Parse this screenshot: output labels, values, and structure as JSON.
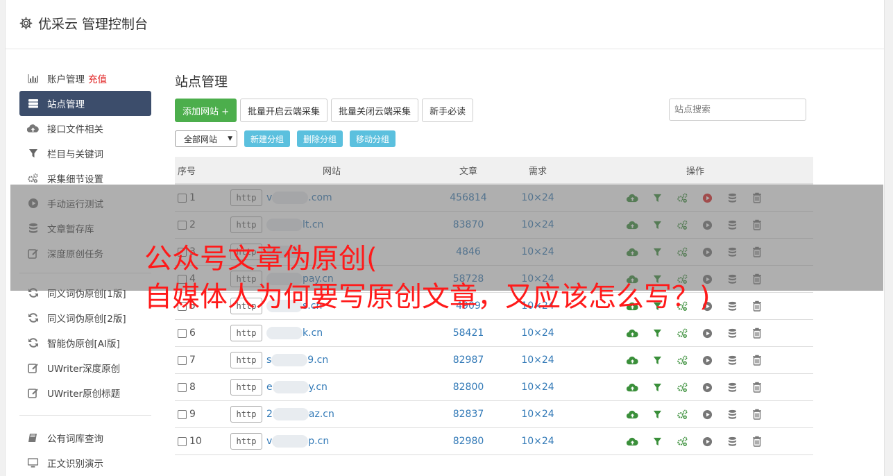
{
  "header": {
    "title": "优采云 管理控制台",
    "icon": "gear-icon"
  },
  "sidebar": {
    "group1": [
      {
        "label": "账户管理",
        "extra": "充值",
        "icon": "bar-chart-icon"
      },
      {
        "label": "站点管理",
        "icon": "server-icon",
        "active": true
      },
      {
        "label": "接口文件相关",
        "icon": "cloud-upload-icon"
      },
      {
        "label": "栏目与关键词",
        "icon": "filter-icon"
      },
      {
        "label": "采集细节设置",
        "icon": "gears-icon"
      },
      {
        "label": "手动运行测试",
        "icon": "play-circle-icon"
      },
      {
        "label": "文章暂存库",
        "icon": "database-icon"
      },
      {
        "label": "深度原创任务",
        "icon": "edit-icon"
      }
    ],
    "group2": [
      {
        "label": "同义词伪原创[1版]",
        "icon": "refresh-icon"
      },
      {
        "label": "同义词伪原创[2版]",
        "icon": "refresh-icon"
      },
      {
        "label": "智能伪原创[AI版]",
        "icon": "refresh-icon"
      },
      {
        "label": "UWriter深度原创",
        "icon": "edit-icon"
      },
      {
        "label": "UWriter原创标题",
        "icon": "edit-icon"
      }
    ],
    "group3": [
      {
        "label": "公有词库查询",
        "icon": "book-icon"
      },
      {
        "label": "正文识别演示",
        "icon": "monitor-icon"
      }
    ]
  },
  "main": {
    "title": "站点管理",
    "buttons": {
      "add": "添加网站 +",
      "batch_on": "批量开启云端采集",
      "batch_off": "批量关闭云端采集",
      "guide": "新手必读"
    },
    "search_placeholder": "站点搜索",
    "filter": {
      "select": "全部网站",
      "new_group": "新建分组",
      "del_group": "删除分组",
      "move_group": "移动分组"
    },
    "columns": {
      "no": "序号",
      "site": "网站",
      "articles": "文章",
      "demand": "需求",
      "ops": "操作"
    },
    "rows": [
      {
        "no": "1",
        "pre": "v",
        "post": ".com",
        "articles": "456814",
        "demand": "10×24",
        "running": true
      },
      {
        "no": "2",
        "pre": "",
        "post": "lt.cn",
        "articles": "83870",
        "demand": "10×24"
      },
      {
        "no": "3",
        "pre": "",
        "post": "",
        "articles": "4846",
        "demand": "10×24"
      },
      {
        "no": "4",
        "pre": "",
        "post": "pay.cn",
        "articles": "58728",
        "demand": "10×24"
      },
      {
        "no": "5",
        "pre": "",
        "post": "s.cn",
        "articles": "4909",
        "demand": "10×24"
      },
      {
        "no": "6",
        "pre": "",
        "post": "k.cn",
        "articles": "58421",
        "demand": "10×24"
      },
      {
        "no": "7",
        "pre": "s",
        "post": "9.cn",
        "articles": "82987",
        "demand": "10×24"
      },
      {
        "no": "8",
        "pre": "e",
        "post": "y.cn",
        "articles": "82800",
        "demand": "10×24"
      },
      {
        "no": "9",
        "pre": "2",
        "post": "az.cn",
        "articles": "82837",
        "demand": "10×24"
      },
      {
        "no": "10",
        "pre": "v",
        "post": "p.cn",
        "articles": "82980",
        "demand": "10×24"
      }
    ],
    "http_label": "http"
  },
  "overlay": {
    "line1": "公众号文章伪原创(",
    "line2": "自媒体人为何要写原创文章，又应该怎么写？)"
  },
  "colors": {
    "green": "#4cae4c",
    "sidebar_active": "#3c4d6b",
    "info": "#5bc0de",
    "link": "#337ab7",
    "headline": "#ff1a1a"
  }
}
